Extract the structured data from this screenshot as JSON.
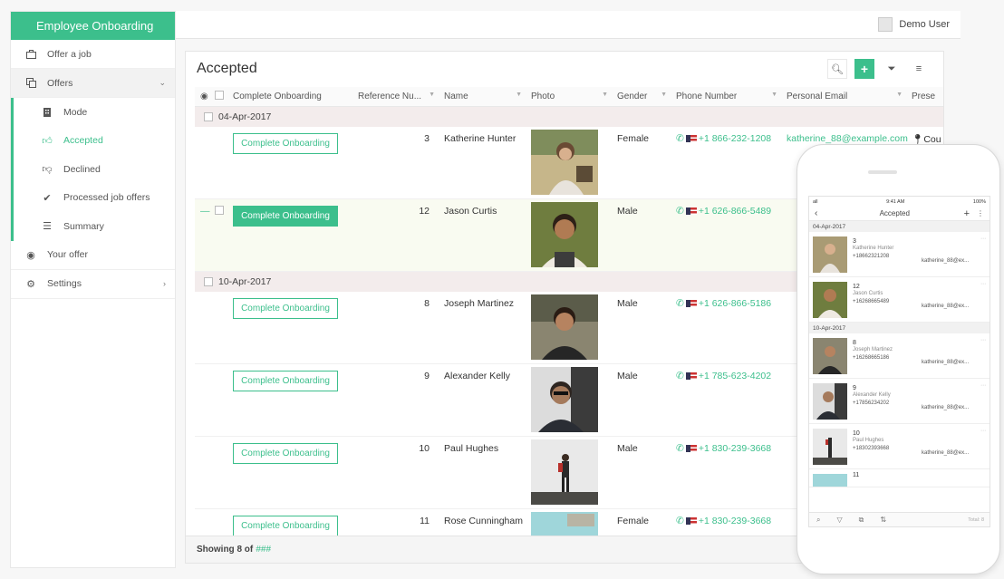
{
  "app": {
    "title": "Employee Onboarding",
    "user": "Demo User"
  },
  "sidebar": {
    "items": [
      {
        "label": "Offer a job",
        "icon": "briefcase-icon"
      },
      {
        "label": "Offers",
        "icon": "copy-icon"
      },
      {
        "label": "Your offer",
        "icon": "eye-icon"
      },
      {
        "label": "Settings",
        "icon": "gear-icon"
      }
    ],
    "sub": [
      {
        "label": "Mode",
        "icon": "building-icon"
      },
      {
        "label": "Accepted",
        "icon": "thumbs-up-icon"
      },
      {
        "label": "Declined",
        "icon": "thumbs-down-icon"
      },
      {
        "label": "Processed job offers",
        "icon": "check-icon"
      },
      {
        "label": "Summary",
        "icon": "list-icon"
      }
    ]
  },
  "panel": {
    "title": "Accepted"
  },
  "columns": [
    "Complete Onboarding",
    "Reference Nu...",
    "Name",
    "Photo",
    "Gender",
    "Phone Number",
    "Personal Email",
    "Prese"
  ],
  "groups": [
    {
      "label": "04-Apr-2017"
    },
    {
      "label": "10-Apr-2017"
    }
  ],
  "rows": [
    {
      "button": "Complete Onboarding",
      "ref": "3",
      "name": "Katherine Hunter",
      "gender": "Female",
      "phone": "+1 866-232-1208",
      "email": "katherine_88@example.com",
      "present": "Cou"
    },
    {
      "button": "Complete Onboarding",
      "ref": "12",
      "name": "Jason Curtis",
      "gender": "Male",
      "phone": "+1 626-866-5489",
      "email": "",
      "present": ""
    },
    {
      "button": "Complete Onboarding",
      "ref": "8",
      "name": "Joseph Martinez",
      "gender": "Male",
      "phone": "+1 626-866-5186",
      "email": "",
      "present": ""
    },
    {
      "button": "Complete Onboarding",
      "ref": "9",
      "name": "Alexander Kelly",
      "gender": "Male",
      "phone": "+1 785-623-4202",
      "email": "",
      "present": ""
    },
    {
      "button": "Complete Onboarding",
      "ref": "10",
      "name": "Paul Hughes",
      "gender": "Male",
      "phone": "+1 830-239-3668",
      "email": "",
      "present": ""
    },
    {
      "button": "Complete Onboarding",
      "ref": "11",
      "name": "Rose Cunningham",
      "gender": "Female",
      "phone": "+1 830-239-3668",
      "email": "",
      "present": ""
    }
  ],
  "footer": {
    "showing": "Showing 8 of",
    "total": "###"
  },
  "mobile": {
    "time": "9:41 AM",
    "carrier": "all",
    "battery": "100%",
    "title": "Accepted",
    "groups": [
      "04-Apr-2017",
      "10-Apr-2017"
    ],
    "rows": [
      {
        "ref": "3",
        "name": "Katherine Hunter",
        "phone": "+18662321208",
        "email": "katherine_88@ex..."
      },
      {
        "ref": "12",
        "name": "Jason Curtis",
        "phone": "+16268665489",
        "email": "katherine_88@ex..."
      },
      {
        "ref": "8",
        "name": "Joseph Martinez",
        "phone": "+16268665186",
        "email": "katherine_88@ex..."
      },
      {
        "ref": "9",
        "name": "Alexander Kelly",
        "phone": "+17856234202",
        "email": "katherine_88@ex..."
      },
      {
        "ref": "10",
        "name": "Paul Hughes",
        "phone": "+18302393668",
        "email": "katherine_88@ex..."
      },
      {
        "ref": "11"
      }
    ],
    "total": "Total: 8"
  },
  "colors": {
    "accent": "#3cbf8c",
    "group_bg": "#f3ecec"
  }
}
